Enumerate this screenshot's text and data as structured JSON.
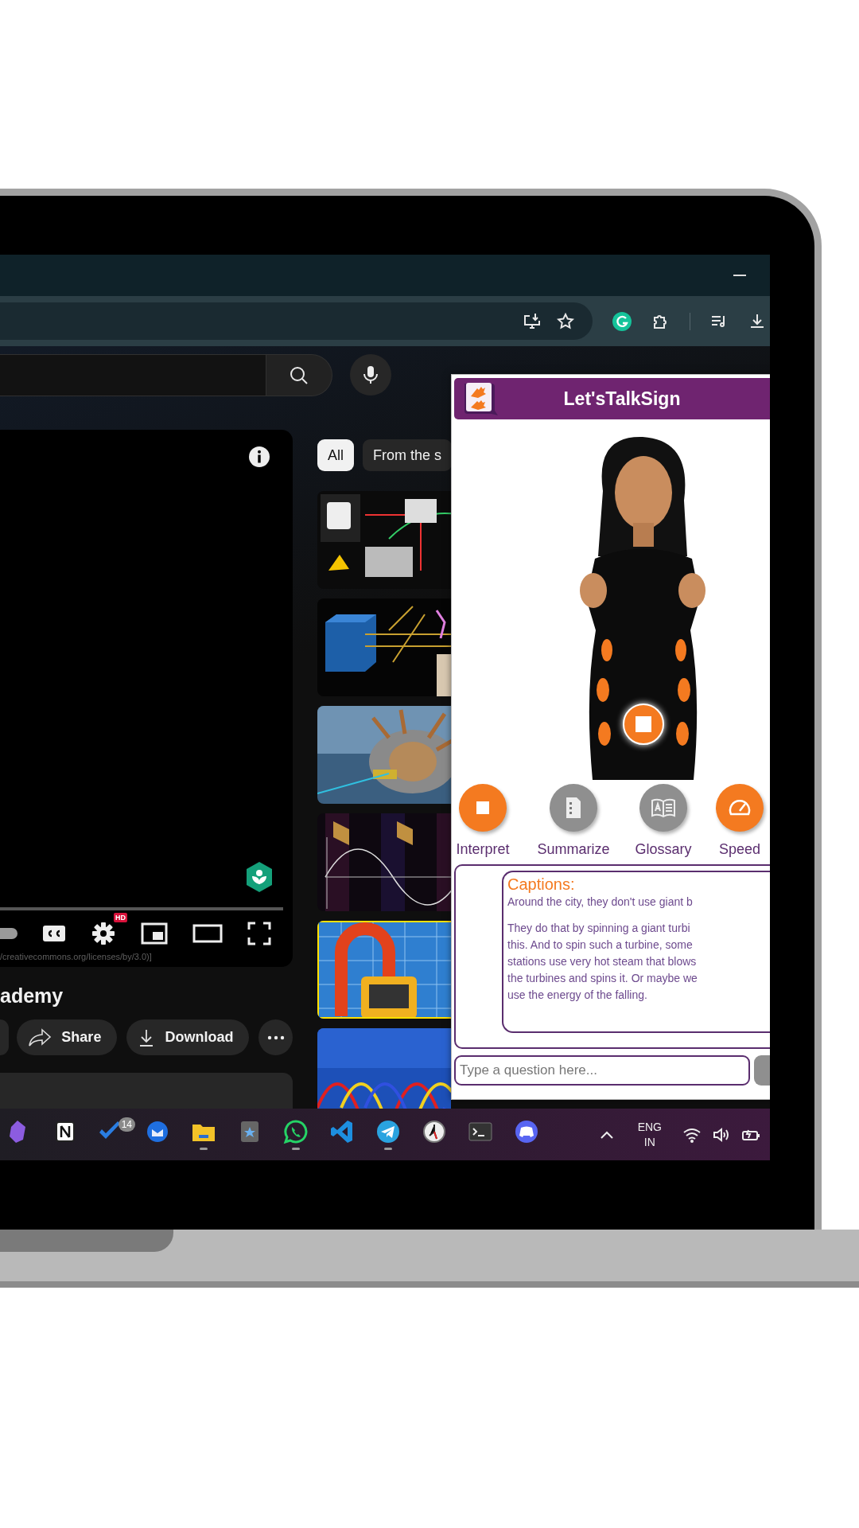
{
  "youtube": {
    "chips": [
      {
        "label": "All",
        "selected": true
      },
      {
        "label": "From the s",
        "selected": false
      }
    ],
    "player": {
      "autoplay_on": false,
      "progress": {
        "level": 0
      },
      "quality_badge": "HD",
      "license": "/creativecommons.org/licenses/by/3.0)]"
    },
    "video_title": "ademy",
    "actions": [
      {
        "kind": "share",
        "label": "Share"
      },
      {
        "kind": "download",
        "label": "Download"
      }
    ]
  },
  "extension": {
    "title": "Let'sTalkSign",
    "controls": [
      {
        "kind": "stop",
        "label": "Interpret",
        "active": true
      },
      {
        "kind": "document",
        "label": "Summarize",
        "active": false
      },
      {
        "kind": "book",
        "label": "Glossary",
        "active": false
      },
      {
        "kind": "gauge",
        "label": "Speed",
        "active": true
      }
    ],
    "captions": {
      "heading": "Captions:",
      "paragraphs": [
        [
          "Around the city, they don't use giant b"
        ],
        [
          "They do that by spinning a giant turbi",
          "this. And to spin such a turbine, some",
          "stations use very hot steam that blows",
          "the turbines and spins it. Or maybe we",
          "use the energy of the falling."
        ]
      ]
    },
    "question": {
      "placeholder": "Type a question here..."
    }
  },
  "taskbar": {
    "apps": [
      {
        "kind": "gem",
        "running": false
      },
      {
        "kind": "notebook",
        "running": false
      },
      {
        "kind": "check",
        "running": false,
        "badge": "14"
      },
      {
        "kind": "mail",
        "running": false
      },
      {
        "kind": "folder",
        "running": true
      },
      {
        "kind": "gallery",
        "running": false
      },
      {
        "kind": "chat",
        "running": true
      },
      {
        "kind": "code",
        "running": false
      },
      {
        "kind": "plane",
        "running": true
      },
      {
        "kind": "clock",
        "running": false
      },
      {
        "kind": "terminal",
        "running": false
      },
      {
        "kind": "gamepad",
        "running": false
      }
    ],
    "language": [
      "ENG",
      "IN"
    ]
  }
}
